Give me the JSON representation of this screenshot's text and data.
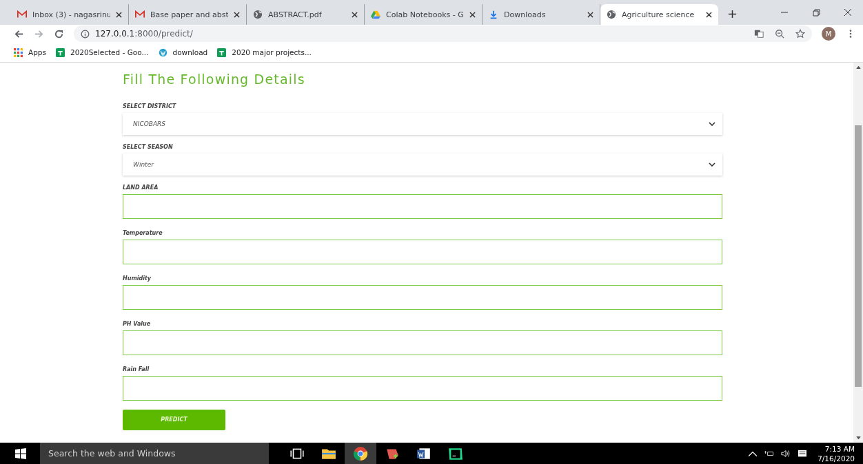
{
  "browser": {
    "tabs": [
      {
        "kind": "mail",
        "title": "Inbox (3) - nagasrinu",
        "selected": false
      },
      {
        "kind": "mail",
        "title": "Base paper and abst",
        "selected": false
      },
      {
        "kind": "globe",
        "title": "ABSTRACT.pdf",
        "selected": false
      },
      {
        "kind": "drive",
        "title": "Colab Notebooks - G",
        "selected": false
      },
      {
        "kind": "download",
        "title": "Downloads",
        "selected": false
      },
      {
        "kind": "globe",
        "title": "Agriculture science",
        "selected": true
      }
    ],
    "address": {
      "host": "127.0.0.1",
      "rest": ":8000/predict/"
    },
    "avatar": "M",
    "bookmarks": [
      {
        "kind": "apps",
        "label": "Apps"
      },
      {
        "kind": "sheet",
        "label": "2020Selected - Goo..."
      },
      {
        "kind": "wp",
        "label": "download"
      },
      {
        "kind": "sheet",
        "label": "2020 major projects..."
      }
    ]
  },
  "form": {
    "heading": "Fill The Following Details",
    "fields": [
      {
        "kind": "select",
        "label": "SELECT DISTRICT",
        "value": "NICOBARS"
      },
      {
        "kind": "select",
        "label": "SELECT SEASON",
        "value": "Winter"
      },
      {
        "kind": "text",
        "label": "LAND AREA"
      },
      {
        "kind": "text",
        "label": "Temperature"
      },
      {
        "kind": "text",
        "label": "Humidity"
      },
      {
        "kind": "text",
        "label": "PH Value"
      },
      {
        "kind": "text",
        "label": "Rain Fall"
      }
    ],
    "submit": "PREDICT"
  },
  "taskbar": {
    "search_placeholder": "Search the web and Windows",
    "time": "7:13 AM",
    "date": "7/16/2020"
  }
}
